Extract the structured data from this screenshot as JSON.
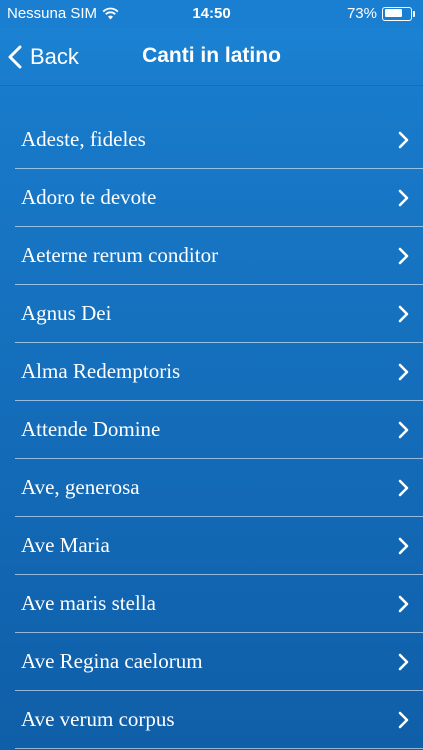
{
  "status_bar": {
    "carrier": "Nessuna SIM",
    "time": "14:50",
    "battery_percent": "73%",
    "battery_level": 0.73,
    "icons": [
      "wifi-icon",
      "battery-icon"
    ]
  },
  "nav": {
    "back_label": "Back",
    "title": "Canti in latino",
    "back_icon": "chevron-left-icon"
  },
  "list": {
    "items": [
      {
        "label": "Adeste, fideles"
      },
      {
        "label": "Adoro te devote"
      },
      {
        "label": "Aeterne rerum conditor"
      },
      {
        "label": "Agnus Dei"
      },
      {
        "label": "Alma Redemptoris"
      },
      {
        "label": "Attende Domine"
      },
      {
        "label": "Ave, generosa"
      },
      {
        "label": "Ave Maria"
      },
      {
        "label": "Ave maris stella"
      },
      {
        "label": "Ave Regina caelorum"
      },
      {
        "label": "Ave verum corpus"
      }
    ],
    "row_icon": "chevron-right-icon"
  },
  "colors": {
    "background": "#1570bd",
    "nav_bar": "#1a7fd0",
    "text": "#ffffff"
  }
}
